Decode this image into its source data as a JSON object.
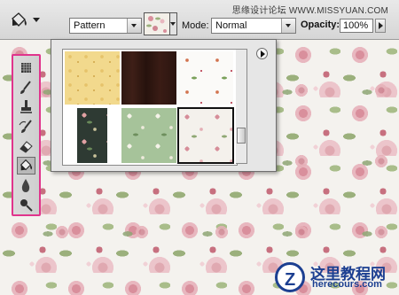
{
  "options_bar": {
    "tool_preset_icon": "paint-bucket-icon",
    "fill_source": "Pattern",
    "mode_label": "Mode:",
    "mode_value": "Normal",
    "opacity_label": "Opacity:",
    "opacity_value": "100%"
  },
  "watermark": "思缘设计论坛 WWW.MISSYUAN.COM",
  "toolbox": {
    "tools": [
      {
        "icon": "stamp-pattern-icon"
      },
      {
        "icon": "brush-icon"
      },
      {
        "icon": "clone-stamp-icon"
      },
      {
        "icon": "history-brush-icon"
      },
      {
        "icon": "eraser-icon"
      },
      {
        "icon": "paint-bucket-icon",
        "selected": true
      },
      {
        "icon": "blur-drop-icon"
      },
      {
        "icon": "dodge-icon"
      }
    ]
  },
  "pattern_picker": {
    "patterns": [
      {
        "name": "yellow-floral"
      },
      {
        "name": "dark-wood"
      },
      {
        "name": "white-floral"
      },
      {
        "name": "dark-green-floral"
      },
      {
        "name": "green-floral"
      },
      {
        "name": "rose-floral",
        "selected": true
      }
    ],
    "menu_icon": "flyout-menu-icon"
  },
  "logo": {
    "title": "这里教程网",
    "subtitle": "herecours.com",
    "mark": "Z"
  }
}
